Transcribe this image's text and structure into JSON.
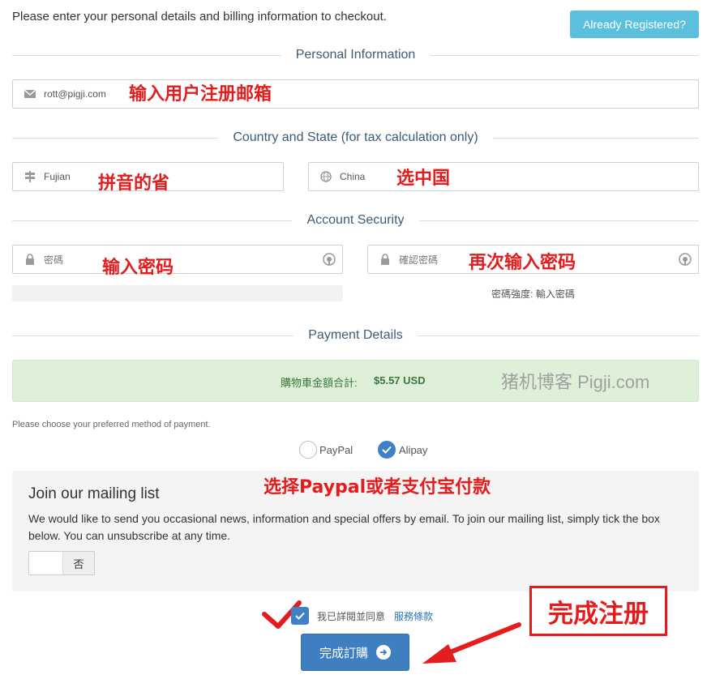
{
  "header": {
    "intro": "Please enter your personal details and billing information to checkout.",
    "already_registered": "Already Registered?"
  },
  "sections": {
    "personal": "Personal Information",
    "country_state": "Country and State (for tax calculation only)",
    "account_security": "Account Security",
    "payment": "Payment Details"
  },
  "fields": {
    "email": {
      "value": "rott@pigji.com",
      "icon": "envelope-icon"
    },
    "state": {
      "value": "Fujian",
      "icon": "signpost-icon"
    },
    "country": {
      "value": "China",
      "icon": "globe-icon"
    },
    "password": {
      "placeholder": "密碼",
      "icon": "lock-icon"
    },
    "confirm_password": {
      "placeholder": "確認密碼",
      "icon": "lock-icon"
    }
  },
  "strength": {
    "label": "密碼強度: 輸入密碼"
  },
  "payment": {
    "total_label": "購物車金額合計:",
    "total_value": "$5.57 USD",
    "choose_text": "Please choose your preferred method of payment.",
    "methods": [
      {
        "label": "PayPal",
        "selected": false
      },
      {
        "label": "Alipay",
        "selected": true
      }
    ]
  },
  "mailing": {
    "title": "Join our mailing list",
    "description": "We would like to send you occasional news, information and special offers by email. To join our mailing list, simply tick the box below. You can unsubscribe at any time.",
    "toggle_label": "否"
  },
  "terms": {
    "text": "我已詳閱並同意",
    "link": "服務條款",
    "checked": true
  },
  "submit": {
    "label": "完成訂購"
  },
  "annotations": {
    "email": "输入用户注册邮箱",
    "state": "拼音的省",
    "country": "选中国",
    "password": "输入密码",
    "confirm": "再次输入密码",
    "payment": "选择Paypal或者支付宝付款",
    "complete": "完成注册"
  },
  "watermark": "猪机博客 Pigji.com",
  "colors": {
    "accent_blue": "#3d7fc0",
    "info_button": "#5bc0de",
    "success_bg": "#dff0d8",
    "annotation_red": "#e31d1d"
  }
}
